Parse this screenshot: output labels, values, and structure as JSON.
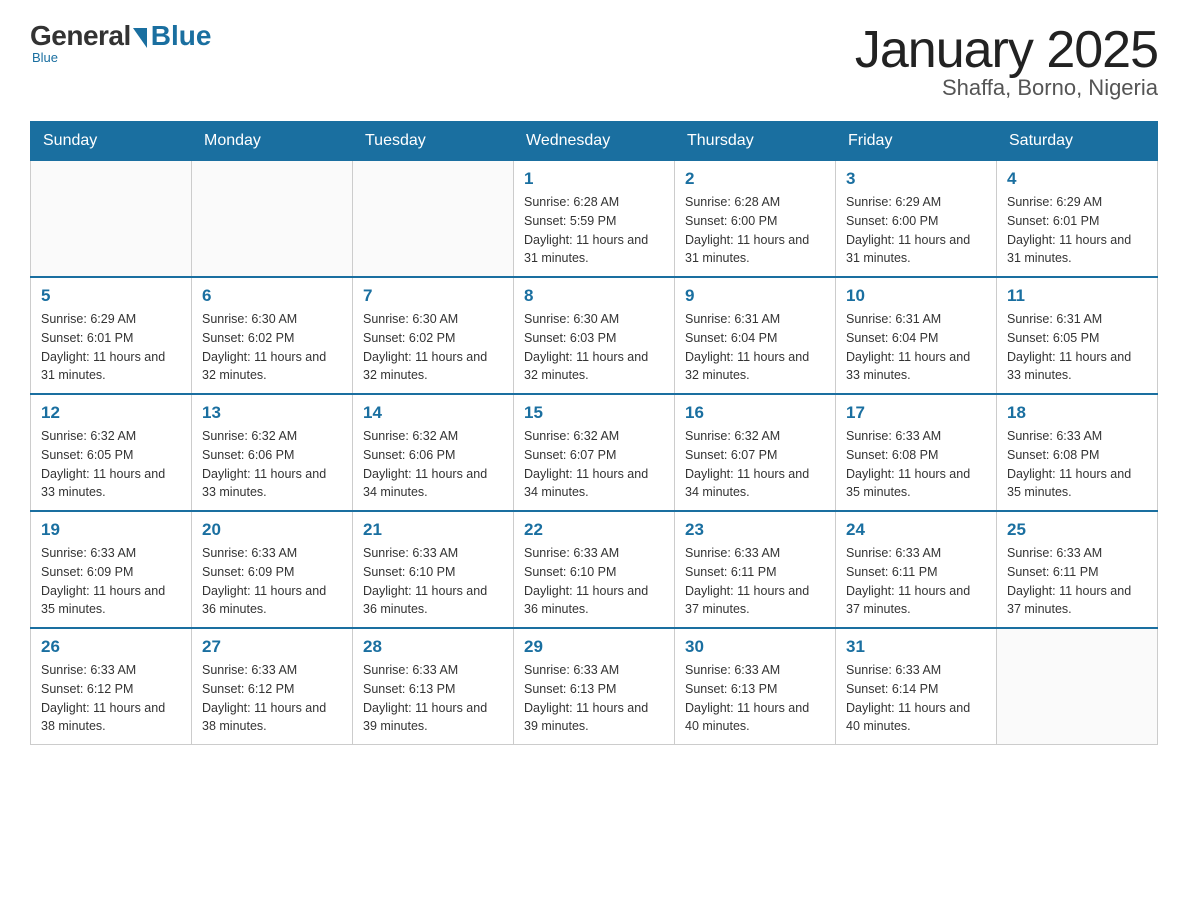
{
  "logo": {
    "general": "General",
    "blue": "Blue",
    "subtitle": "Blue"
  },
  "header": {
    "month_year": "January 2025",
    "location": "Shaffa, Borno, Nigeria"
  },
  "weekdays": [
    "Sunday",
    "Monday",
    "Tuesday",
    "Wednesday",
    "Thursday",
    "Friday",
    "Saturday"
  ],
  "weeks": [
    {
      "days": [
        {
          "number": "",
          "sunrise": "",
          "sunset": "",
          "daylight": ""
        },
        {
          "number": "",
          "sunrise": "",
          "sunset": "",
          "daylight": ""
        },
        {
          "number": "",
          "sunrise": "",
          "sunset": "",
          "daylight": ""
        },
        {
          "number": "1",
          "sunrise": "Sunrise: 6:28 AM",
          "sunset": "Sunset: 5:59 PM",
          "daylight": "Daylight: 11 hours and 31 minutes."
        },
        {
          "number": "2",
          "sunrise": "Sunrise: 6:28 AM",
          "sunset": "Sunset: 6:00 PM",
          "daylight": "Daylight: 11 hours and 31 minutes."
        },
        {
          "number": "3",
          "sunrise": "Sunrise: 6:29 AM",
          "sunset": "Sunset: 6:00 PM",
          "daylight": "Daylight: 11 hours and 31 minutes."
        },
        {
          "number": "4",
          "sunrise": "Sunrise: 6:29 AM",
          "sunset": "Sunset: 6:01 PM",
          "daylight": "Daylight: 11 hours and 31 minutes."
        }
      ]
    },
    {
      "days": [
        {
          "number": "5",
          "sunrise": "Sunrise: 6:29 AM",
          "sunset": "Sunset: 6:01 PM",
          "daylight": "Daylight: 11 hours and 31 minutes."
        },
        {
          "number": "6",
          "sunrise": "Sunrise: 6:30 AM",
          "sunset": "Sunset: 6:02 PM",
          "daylight": "Daylight: 11 hours and 32 minutes."
        },
        {
          "number": "7",
          "sunrise": "Sunrise: 6:30 AM",
          "sunset": "Sunset: 6:02 PM",
          "daylight": "Daylight: 11 hours and 32 minutes."
        },
        {
          "number": "8",
          "sunrise": "Sunrise: 6:30 AM",
          "sunset": "Sunset: 6:03 PM",
          "daylight": "Daylight: 11 hours and 32 minutes."
        },
        {
          "number": "9",
          "sunrise": "Sunrise: 6:31 AM",
          "sunset": "Sunset: 6:04 PM",
          "daylight": "Daylight: 11 hours and 32 minutes."
        },
        {
          "number": "10",
          "sunrise": "Sunrise: 6:31 AM",
          "sunset": "Sunset: 6:04 PM",
          "daylight": "Daylight: 11 hours and 33 minutes."
        },
        {
          "number": "11",
          "sunrise": "Sunrise: 6:31 AM",
          "sunset": "Sunset: 6:05 PM",
          "daylight": "Daylight: 11 hours and 33 minutes."
        }
      ]
    },
    {
      "days": [
        {
          "number": "12",
          "sunrise": "Sunrise: 6:32 AM",
          "sunset": "Sunset: 6:05 PM",
          "daylight": "Daylight: 11 hours and 33 minutes."
        },
        {
          "number": "13",
          "sunrise": "Sunrise: 6:32 AM",
          "sunset": "Sunset: 6:06 PM",
          "daylight": "Daylight: 11 hours and 33 minutes."
        },
        {
          "number": "14",
          "sunrise": "Sunrise: 6:32 AM",
          "sunset": "Sunset: 6:06 PM",
          "daylight": "Daylight: 11 hours and 34 minutes."
        },
        {
          "number": "15",
          "sunrise": "Sunrise: 6:32 AM",
          "sunset": "Sunset: 6:07 PM",
          "daylight": "Daylight: 11 hours and 34 minutes."
        },
        {
          "number": "16",
          "sunrise": "Sunrise: 6:32 AM",
          "sunset": "Sunset: 6:07 PM",
          "daylight": "Daylight: 11 hours and 34 minutes."
        },
        {
          "number": "17",
          "sunrise": "Sunrise: 6:33 AM",
          "sunset": "Sunset: 6:08 PM",
          "daylight": "Daylight: 11 hours and 35 minutes."
        },
        {
          "number": "18",
          "sunrise": "Sunrise: 6:33 AM",
          "sunset": "Sunset: 6:08 PM",
          "daylight": "Daylight: 11 hours and 35 minutes."
        }
      ]
    },
    {
      "days": [
        {
          "number": "19",
          "sunrise": "Sunrise: 6:33 AM",
          "sunset": "Sunset: 6:09 PM",
          "daylight": "Daylight: 11 hours and 35 minutes."
        },
        {
          "number": "20",
          "sunrise": "Sunrise: 6:33 AM",
          "sunset": "Sunset: 6:09 PM",
          "daylight": "Daylight: 11 hours and 36 minutes."
        },
        {
          "number": "21",
          "sunrise": "Sunrise: 6:33 AM",
          "sunset": "Sunset: 6:10 PM",
          "daylight": "Daylight: 11 hours and 36 minutes."
        },
        {
          "number": "22",
          "sunrise": "Sunrise: 6:33 AM",
          "sunset": "Sunset: 6:10 PM",
          "daylight": "Daylight: 11 hours and 36 minutes."
        },
        {
          "number": "23",
          "sunrise": "Sunrise: 6:33 AM",
          "sunset": "Sunset: 6:11 PM",
          "daylight": "Daylight: 11 hours and 37 minutes."
        },
        {
          "number": "24",
          "sunrise": "Sunrise: 6:33 AM",
          "sunset": "Sunset: 6:11 PM",
          "daylight": "Daylight: 11 hours and 37 minutes."
        },
        {
          "number": "25",
          "sunrise": "Sunrise: 6:33 AM",
          "sunset": "Sunset: 6:11 PM",
          "daylight": "Daylight: 11 hours and 37 minutes."
        }
      ]
    },
    {
      "days": [
        {
          "number": "26",
          "sunrise": "Sunrise: 6:33 AM",
          "sunset": "Sunset: 6:12 PM",
          "daylight": "Daylight: 11 hours and 38 minutes."
        },
        {
          "number": "27",
          "sunrise": "Sunrise: 6:33 AM",
          "sunset": "Sunset: 6:12 PM",
          "daylight": "Daylight: 11 hours and 38 minutes."
        },
        {
          "number": "28",
          "sunrise": "Sunrise: 6:33 AM",
          "sunset": "Sunset: 6:13 PM",
          "daylight": "Daylight: 11 hours and 39 minutes."
        },
        {
          "number": "29",
          "sunrise": "Sunrise: 6:33 AM",
          "sunset": "Sunset: 6:13 PM",
          "daylight": "Daylight: 11 hours and 39 minutes."
        },
        {
          "number": "30",
          "sunrise": "Sunrise: 6:33 AM",
          "sunset": "Sunset: 6:13 PM",
          "daylight": "Daylight: 11 hours and 40 minutes."
        },
        {
          "number": "31",
          "sunrise": "Sunrise: 6:33 AM",
          "sunset": "Sunset: 6:14 PM",
          "daylight": "Daylight: 11 hours and 40 minutes."
        },
        {
          "number": "",
          "sunrise": "",
          "sunset": "",
          "daylight": ""
        }
      ]
    }
  ]
}
